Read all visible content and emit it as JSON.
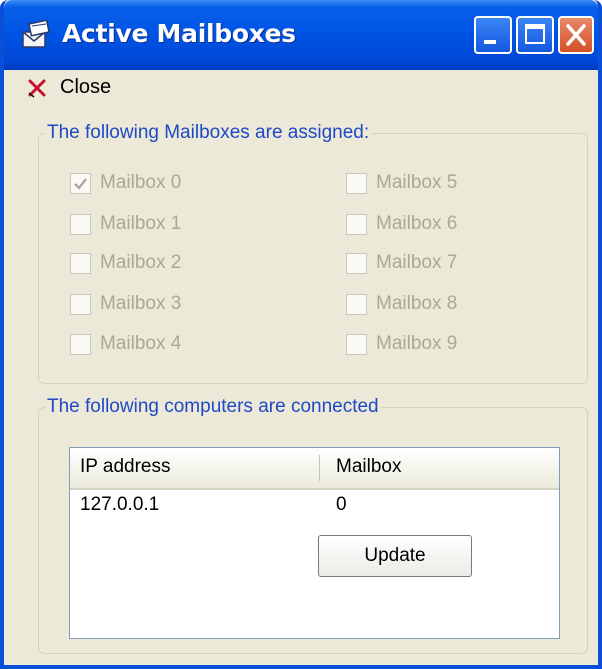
{
  "window": {
    "title": "Active Mailboxes",
    "icon": "mailbox-envelope-icon",
    "controls": [
      "minimize-icon",
      "maximize-icon",
      "close-icon"
    ]
  },
  "menu": {
    "close_label": "Close",
    "close_icon": "close-x-icon"
  },
  "mailboxes_group": {
    "legend": "The following Mailboxes are assigned:",
    "items": [
      {
        "label": "Mailbox 0",
        "checked": true
      },
      {
        "label": "Mailbox 1",
        "checked": false
      },
      {
        "label": "Mailbox 2",
        "checked": false
      },
      {
        "label": "Mailbox 3",
        "checked": false
      },
      {
        "label": "Mailbox 4",
        "checked": false
      },
      {
        "label": "Mailbox 5",
        "checked": false
      },
      {
        "label": "Mailbox 6",
        "checked": false
      },
      {
        "label": "Mailbox 7",
        "checked": false
      },
      {
        "label": "Mailbox 8",
        "checked": false
      },
      {
        "label": "Mailbox 9",
        "checked": false
      }
    ]
  },
  "computers_group": {
    "legend": "The following computers are connected",
    "columns": [
      "IP address",
      "Mailbox"
    ],
    "rows": [
      {
        "ip": "127.0.0.1",
        "mailbox": "0"
      }
    ],
    "update_label": "Update"
  },
  "colors": {
    "title_bar": "#0055e5",
    "legend_text": "#1f49c6",
    "disabled_text": "#aca899",
    "dialog_bg": "#ece9d8"
  }
}
